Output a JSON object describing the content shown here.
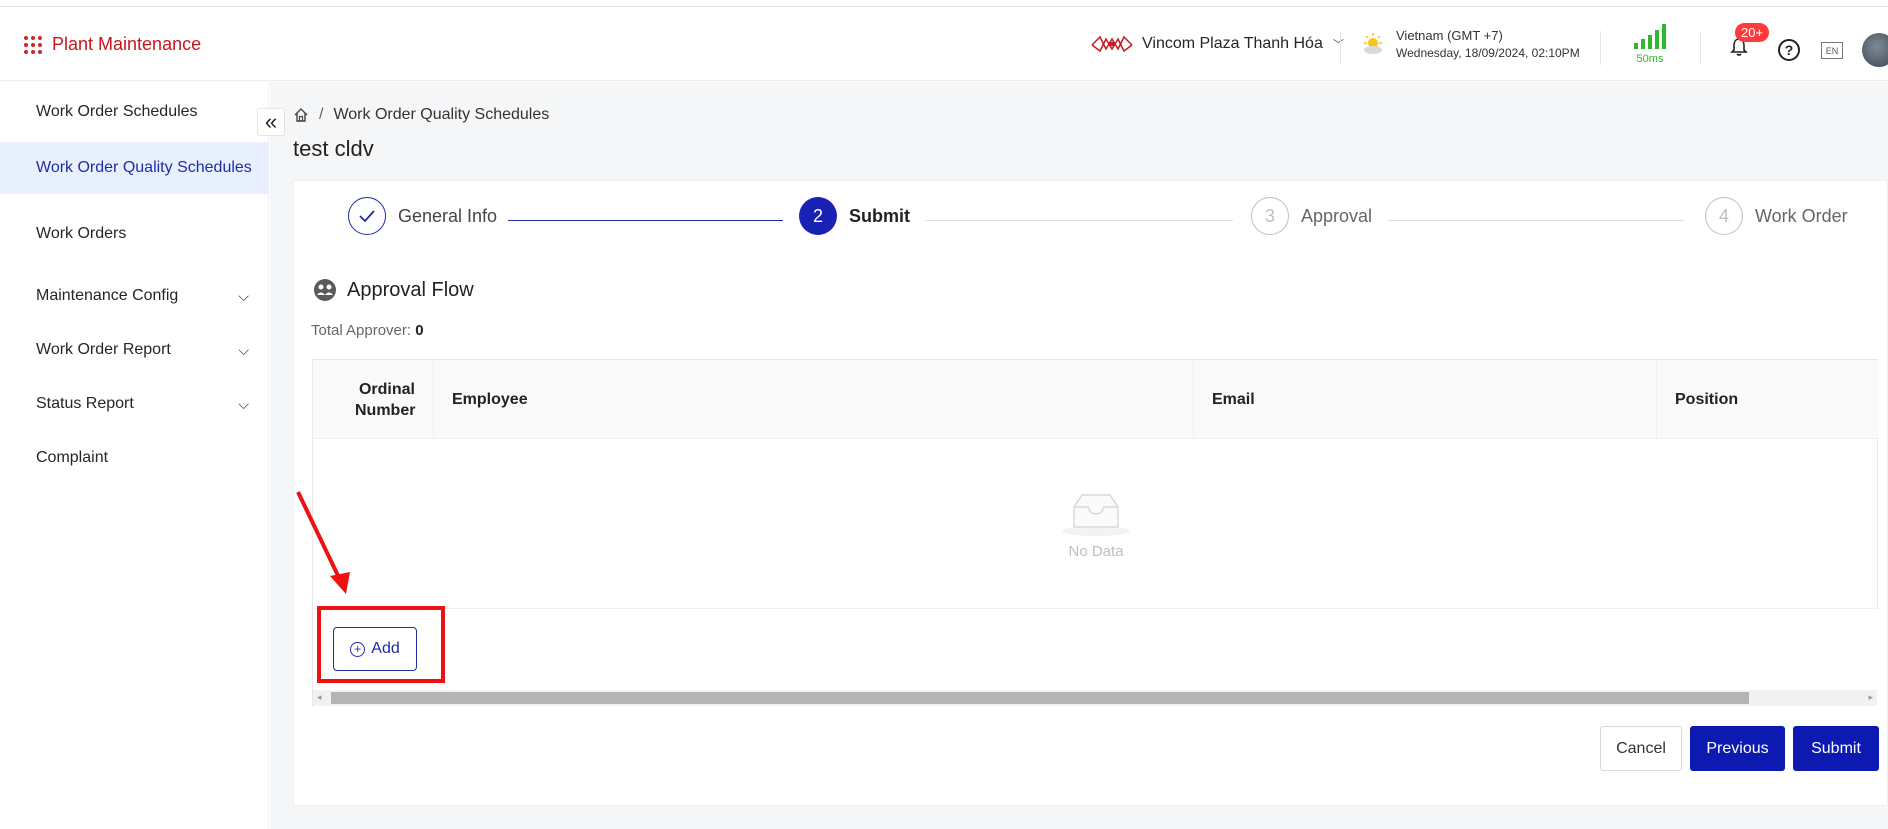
{
  "header": {
    "brand": "Plant Maintenance",
    "site_name": "Vincom Plaza Thanh Hóa",
    "timezone": "Vietnam (GMT +7)",
    "datetime": "Wednesday, 18/09/2024, 02:10PM",
    "latency": "50ms",
    "notification_count": "20+",
    "help": "?",
    "language": "EN"
  },
  "sidebar": {
    "items": [
      {
        "label": "Work Order Schedules",
        "active": false
      },
      {
        "label": "Work Order Quality Schedules",
        "active": true
      },
      {
        "label": "Work Orders",
        "active": false
      },
      {
        "label": "Maintenance Config",
        "expandable": true
      },
      {
        "label": "Work Order Report",
        "expandable": true
      },
      {
        "label": "Status Report",
        "expandable": true
      },
      {
        "label": "Complaint",
        "active": false
      }
    ]
  },
  "breadcrumb": {
    "current": "Work Order Quality Schedules"
  },
  "page": {
    "title": "test cldv"
  },
  "steps": [
    {
      "number": "1",
      "label": "General Info",
      "status": "done"
    },
    {
      "number": "2",
      "label": "Submit",
      "status": "active"
    },
    {
      "number": "3",
      "label": "Approval",
      "status": "wait"
    },
    {
      "number": "4",
      "label": "Work Order",
      "status": "wait"
    }
  ],
  "approval_flow": {
    "title": "Approval Flow",
    "total_label": "Total Approver:",
    "total_value": "0",
    "columns": [
      "Ordinal Number",
      "Employee",
      "Email",
      "Position"
    ],
    "empty_text": "No Data",
    "add_label": "Add"
  },
  "actions": {
    "cancel": "Cancel",
    "previous": "Previous",
    "submit": "Submit"
  },
  "colors": {
    "primary": "#0c1ab2",
    "brand_red": "#c8161d",
    "annotation": "#ee1111",
    "signal": "#2eb82e"
  }
}
